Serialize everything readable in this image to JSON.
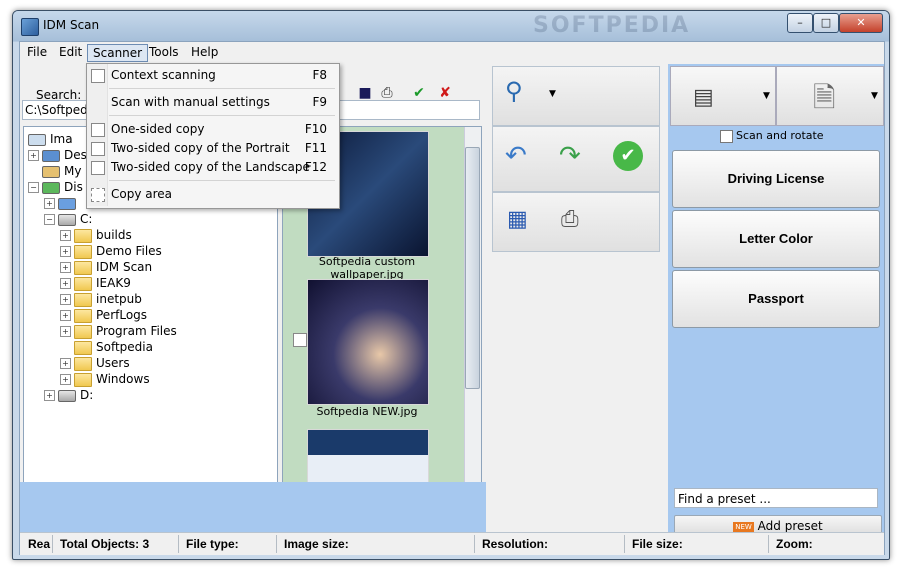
{
  "window": {
    "title": "IDM Scan",
    "watermark": "SOFTPEDIA"
  },
  "menubar": {
    "file": "File",
    "edit": "Edit",
    "scanner": "Scanner",
    "tools": "Tools",
    "help": "Help"
  },
  "scanner_menu": [
    {
      "label": "Context scanning",
      "key": "F8"
    },
    {
      "label": "Scan with manual settings",
      "key": "F9"
    },
    {
      "label": "One-sided copy",
      "key": "F10"
    },
    {
      "label": "Two-sided copy of the Portrait",
      "key": "F11"
    },
    {
      "label": "Two-sided copy of the Landscape",
      "key": "F12"
    },
    {
      "label": "Copy area",
      "key": ""
    }
  ],
  "search": {
    "label": "Search:"
  },
  "path": "C:\\Softpedia",
  "tree": {
    "top": [
      {
        "label": "Ima"
      },
      {
        "label": "Des"
      },
      {
        "label": "My"
      },
      {
        "label": "Dis"
      }
    ],
    "drive_c": "C:",
    "folders": [
      "builds",
      "Demo Files",
      "IDM Scan",
      "IEAK9",
      "inetpub",
      "PerfLogs",
      "Program Files",
      "Softpedia",
      "Users",
      "Windows"
    ],
    "drive_d": "D:"
  },
  "thumbnails": [
    {
      "caption": "Softpedia custom wallpaper.jpg"
    },
    {
      "caption": "Softpedia NEW.jpg"
    },
    {
      "caption": ""
    }
  ],
  "right": {
    "scan_rotate": "Scan and rotate",
    "buttons": [
      "Driving License",
      "Letter Color",
      "Passport"
    ],
    "preset_placeholder": "Find a preset ...",
    "add_preset": "Add preset",
    "new_badge": "NEW"
  },
  "status": {
    "rea": "Rea",
    "total_objects": "Total Objects: 3",
    "file_type": "File type:",
    "image_size": "Image size:",
    "resolution": "Resolution:",
    "file_size": "File size:",
    "zoom": "Zoom:"
  }
}
